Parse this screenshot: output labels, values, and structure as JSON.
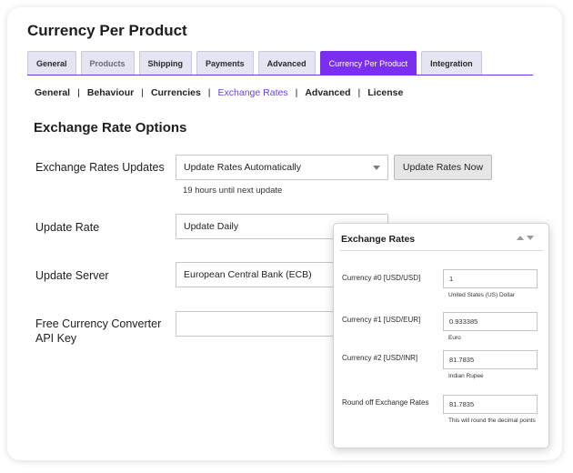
{
  "page": {
    "title": "Currency Per Product"
  },
  "tabs": [
    {
      "label": "General",
      "state": "normal"
    },
    {
      "label": "Products",
      "state": "muted"
    },
    {
      "label": "Shipping",
      "state": "normal"
    },
    {
      "label": "Payments",
      "state": "normal"
    },
    {
      "label": "Advanced",
      "state": "normal"
    },
    {
      "label": "Currency Per Product",
      "state": "active"
    },
    {
      "label": "Integration",
      "state": "normal"
    }
  ],
  "subnav": {
    "items": [
      "General",
      "Behaviour",
      "Currencies",
      "Exchange Rates",
      "Advanced",
      "License"
    ],
    "current": "Exchange Rates",
    "separator": "|"
  },
  "section": {
    "title": "Exchange Rate Options"
  },
  "form": {
    "updates": {
      "label": "Exchange Rates Updates",
      "value": "Update Rates Automatically",
      "button": "Update Rates Now",
      "hint": "19 hours until next update"
    },
    "rate": {
      "label": "Update Rate",
      "value": "Update Daily"
    },
    "server": {
      "label": "Update Server",
      "value": "European Central Bank (ECB)"
    },
    "api_key": {
      "label_line1": "Free Currency Converter",
      "label_line2": "API Key",
      "value": ""
    }
  },
  "popup": {
    "title": "Exchange Rates",
    "rows": [
      {
        "label": "Currency #0 [USD/USD]",
        "value": "1",
        "note": "United States (US) Dollar"
      },
      {
        "label": "Currency #1 [USD/EUR]",
        "value": "0.933385",
        "note": "Euro"
      },
      {
        "label": "Currency #2 [USD/INR]",
        "value": "81.7835",
        "note": "Indian Rupee"
      },
      {
        "label": "Round off Exchange Rates",
        "value": "81.7835",
        "note": "This will round the decimal points"
      }
    ]
  },
  "colors": {
    "accent": "#7a2ef0",
    "tab_bg": "#e4e4f3",
    "current_link": "#6f3de0"
  },
  "icons": {
    "dropdown": "caret-down-icon",
    "sort": "sort-arrows-icon"
  }
}
